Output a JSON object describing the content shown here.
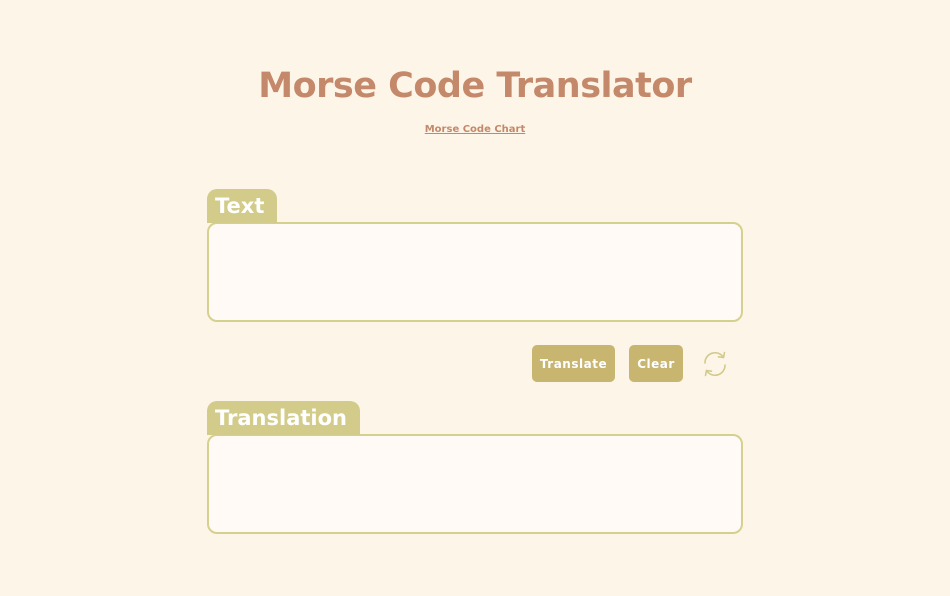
{
  "header": {
    "title": "Morse Code Translator",
    "chart_link": "Morse Code Chart"
  },
  "input": {
    "label": "Text",
    "value": "",
    "placeholder": ""
  },
  "actions": {
    "translate_label": "Translate",
    "clear_label": "Clear",
    "swap_icon": "swap-arrows-icon"
  },
  "output": {
    "label": "Translation",
    "value": "",
    "placeholder": ""
  },
  "colors": {
    "background": "#fdf6e8",
    "title": "#c4886a",
    "tab": "#d2cb8a",
    "border": "#d6d08f",
    "button": "#c8b570",
    "field": "#fffaf5"
  }
}
